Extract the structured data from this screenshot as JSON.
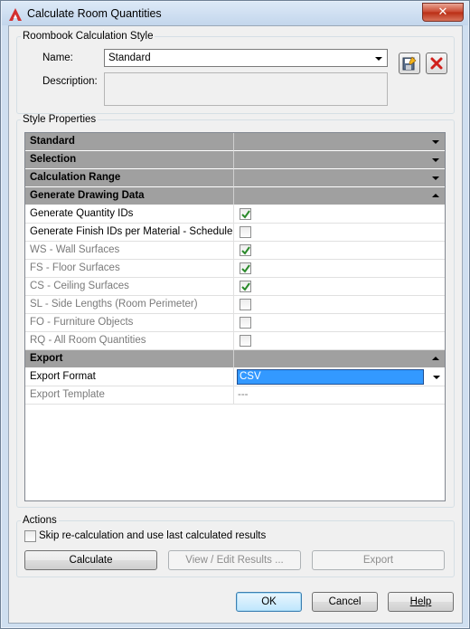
{
  "window": {
    "title": "Calculate Room Quantities",
    "close_glyph": "✕"
  },
  "style_group": {
    "label": "Roombook Calculation Style",
    "name_label": "Name:",
    "name_value": "Standard",
    "description_label": "Description:",
    "description_value": ""
  },
  "properties_group": {
    "label": "Style Properties"
  },
  "grid": {
    "rows": [
      {
        "kind": "category",
        "label": "Standard",
        "expanded": false
      },
      {
        "kind": "category",
        "label": "Selection",
        "expanded": false
      },
      {
        "kind": "category",
        "label": "Calculation Range",
        "expanded": false
      },
      {
        "kind": "category",
        "label": "Generate Drawing Data",
        "expanded": true
      },
      {
        "kind": "check",
        "label": "Generate Quantity IDs",
        "checked": true,
        "enabled": true
      },
      {
        "kind": "check",
        "label": "Generate Finish IDs per Material - Schedule",
        "checked": false,
        "enabled": true
      },
      {
        "kind": "check",
        "label": "WS - Wall Surfaces",
        "checked": true,
        "enabled": false
      },
      {
        "kind": "check",
        "label": "FS - Floor Surfaces",
        "checked": true,
        "enabled": false
      },
      {
        "kind": "check",
        "label": "CS - Ceiling Surfaces",
        "checked": true,
        "enabled": false
      },
      {
        "kind": "check",
        "label": "SL - Side Lengths (Room Perimeter)",
        "checked": false,
        "enabled": false
      },
      {
        "kind": "check",
        "label": "FO - Furniture Objects",
        "checked": false,
        "enabled": false
      },
      {
        "kind": "check",
        "label": "RQ - All Room Quantities",
        "checked": false,
        "enabled": false
      },
      {
        "kind": "category",
        "label": "Export",
        "expanded": true
      },
      {
        "kind": "select",
        "label": "Export Format",
        "value": "CSV"
      },
      {
        "kind": "text",
        "label": "Export Template",
        "value": "---",
        "enabled": false
      }
    ]
  },
  "actions": {
    "label": "Actions",
    "skip_label": "Skip re-calculation and use last calculated results",
    "skip_checked": false,
    "calculate_label": "Calculate",
    "view_edit_label": "View / Edit Results ...",
    "export_label": "Export"
  },
  "footer": {
    "ok_label": "OK",
    "cancel_label": "Cancel",
    "help_label": "Help"
  },
  "colors": {
    "selection": "#3399ff",
    "category_band": "#a0a0a0",
    "check_green": "#2a8a2a"
  }
}
